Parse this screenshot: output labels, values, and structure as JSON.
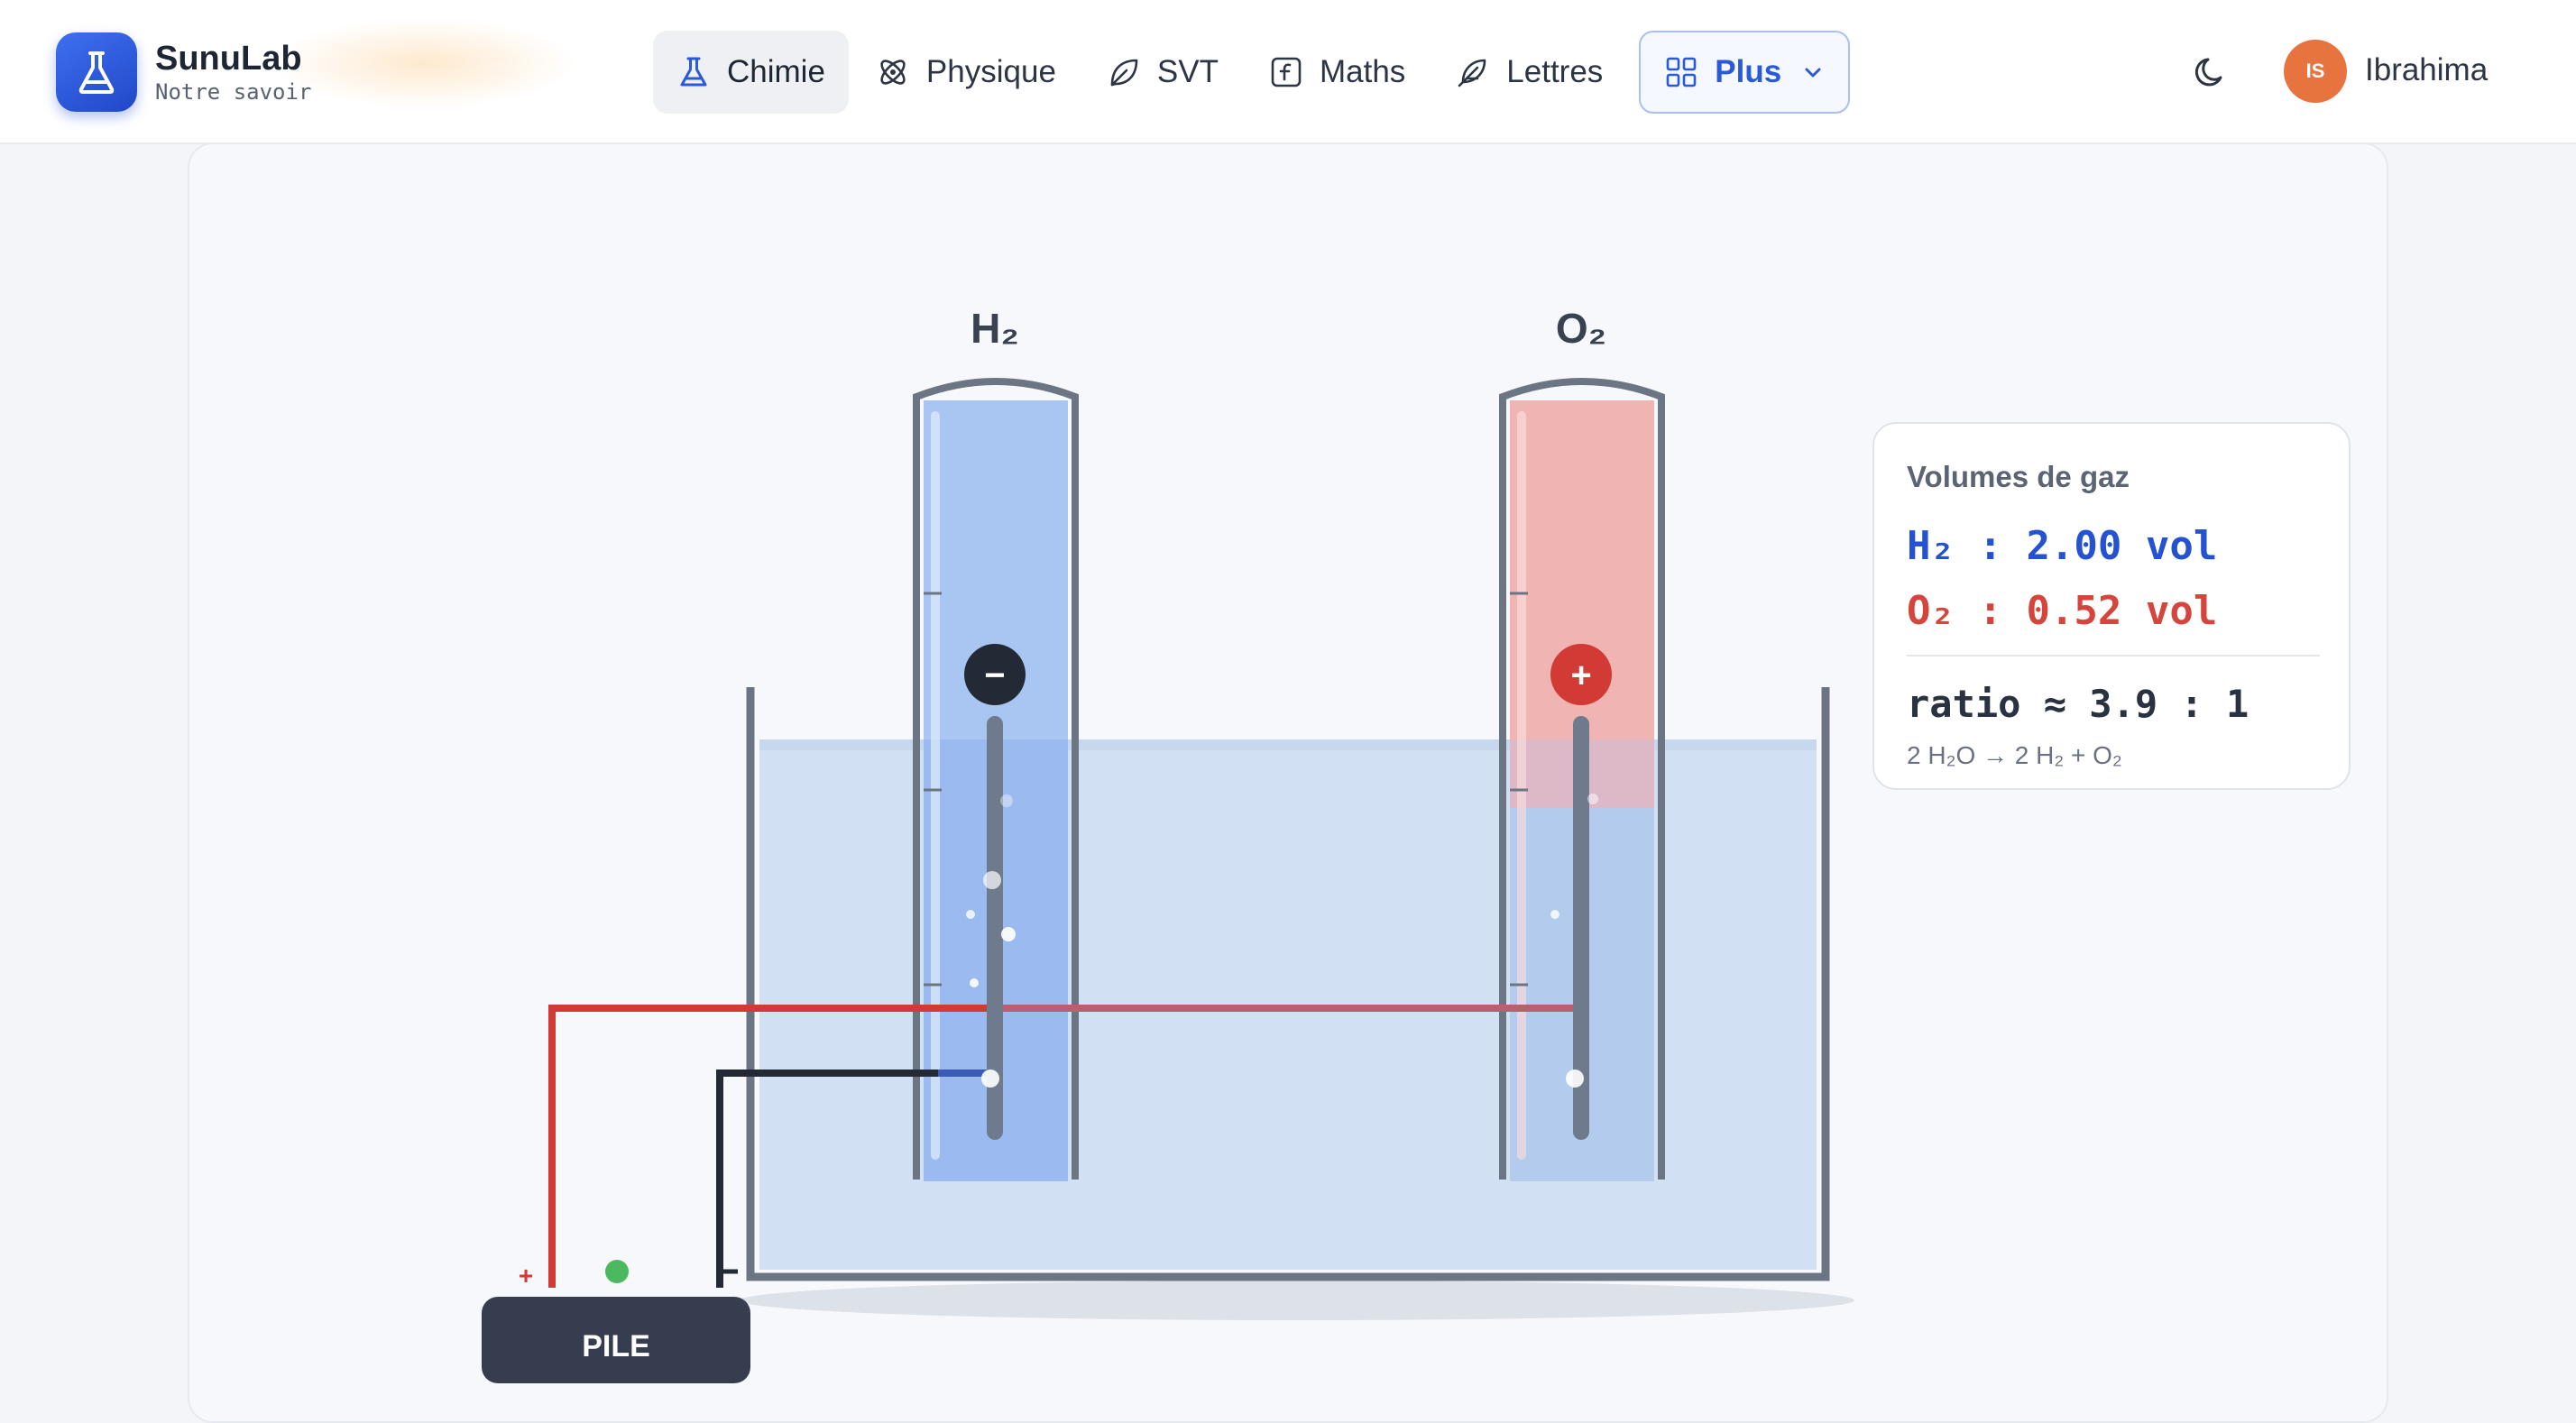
{
  "app": {
    "name": "SunuLab",
    "tagline": "Notre savoir"
  },
  "nav": {
    "items": [
      {
        "label": "Chimie",
        "icon": "flask-icon",
        "active": true
      },
      {
        "label": "Physique",
        "icon": "atom-icon",
        "active": false
      },
      {
        "label": "SVT",
        "icon": "leaf-icon",
        "active": false
      },
      {
        "label": "Maths",
        "icon": "function-icon",
        "active": false
      },
      {
        "label": "Lettres",
        "icon": "feather-icon",
        "active": false
      }
    ],
    "more": {
      "label": "Plus",
      "icon": "grid-icon"
    }
  },
  "user": {
    "initials": "IS",
    "name": "Ibrahima",
    "avatar_color": "#e7743f"
  },
  "experiment": {
    "tube_h2": {
      "label": "H₂",
      "electrode": "−",
      "gas_fill": 1.0,
      "color": "#9bbcf0"
    },
    "tube_o2": {
      "label": "O₂",
      "electrode": "+",
      "gas_fill": 0.52,
      "color": "#f0b4b2"
    },
    "battery": {
      "label": "PILE",
      "plus": "+"
    }
  },
  "gas_volumes": {
    "title": "Volumes de gaz",
    "h2_line": "H₂ : 2.00 vol",
    "o2_line": "O₂ : 0.52 vol",
    "ratio_line": "ratio ≈ 3.9 : 1",
    "equation": "2 H₂O → 2 H₂ + O₂"
  },
  "colors": {
    "brand": "#2a5ad8",
    "h2": "#2452d1",
    "o2": "#d5453c",
    "wire_red": "#d23a35",
    "wire_dark": "#232a36"
  }
}
